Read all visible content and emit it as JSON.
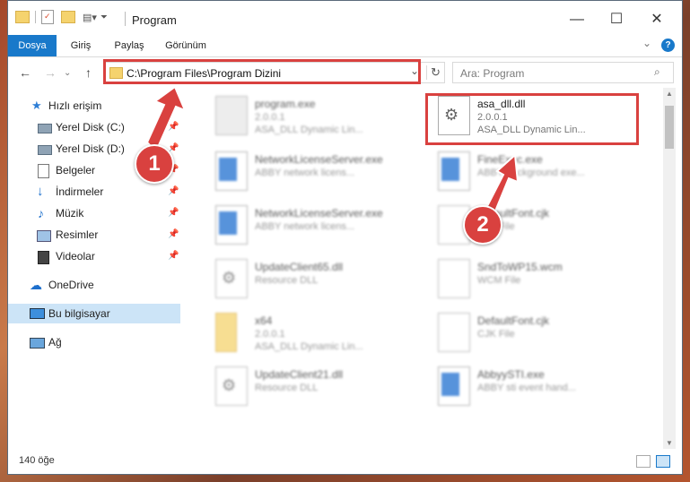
{
  "window": {
    "title": "Program",
    "minimize": "—",
    "maximize": "☐",
    "close": "✕"
  },
  "ribbon": {
    "tabs": [
      {
        "label": "Dosya",
        "active": true
      },
      {
        "label": "Giriş"
      },
      {
        "label": "Paylaş"
      },
      {
        "label": "Görünüm"
      }
    ],
    "expand": "⌄",
    "help": "?"
  },
  "nav": {
    "back": "←",
    "forward": "→",
    "up": "↑",
    "address": "C:\\Program Files\\Program Dizini",
    "dropdown": "⌄",
    "refresh": "↻",
    "search_placeholder": "Ara: Program"
  },
  "sidebar": {
    "items": [
      {
        "label": "Hızlı erişim",
        "icon": "star-icon"
      },
      {
        "label": "Yerel Disk (C:)",
        "icon": "drive-icon",
        "pinned": true
      },
      {
        "label": "Yerel Disk (D:)",
        "icon": "drive-icon",
        "pinned": true
      },
      {
        "label": "Belgeler",
        "icon": "documents-icon",
        "pinned": true
      },
      {
        "label": "İndirmeler",
        "icon": "download-icon",
        "pinned": true
      },
      {
        "label": "Müzik",
        "icon": "music-icon",
        "pinned": true
      },
      {
        "label": "Resimler",
        "icon": "pictures-icon",
        "pinned": true
      },
      {
        "label": "Videolar",
        "icon": "video-icon",
        "pinned": true
      },
      {
        "label": "OneDrive",
        "icon": "onedrive-icon"
      },
      {
        "label": "Bu bilgisayar",
        "icon": "pc-icon",
        "selected": true
      },
      {
        "label": "Ağ",
        "icon": "network-icon"
      }
    ],
    "pin_glyph": "📌"
  },
  "files": [
    {
      "name": "program.exe",
      "l1": "2.0.0.1",
      "l2": "ASA_DLL Dynamic Lin...",
      "icon": "exe-gear-icon",
      "blur": true
    },
    {
      "name": "asa_dll.dll",
      "l1": "2.0.0.1",
      "l2": "ASA_DLL Dynamic Lin...",
      "icon": "dll-gear-icon",
      "blur": false
    },
    {
      "name": "NetworkLicenseServer.exe",
      "l1": "ABBY network licens...",
      "l2": "",
      "icon": "app-window-icon",
      "blur": true
    },
    {
      "name": "FineExec.exe",
      "l1": "ABBY background exe...",
      "l2": "",
      "icon": "app-window-icon",
      "blur": true
    },
    {
      "name": "NetworkLicenseServer.exe",
      "l1": "ABBY network licens...",
      "l2": "",
      "icon": "app-window-icon",
      "blur": true
    },
    {
      "name": "DefaultFont.cjk",
      "l1": "CJK File",
      "l2": "",
      "icon": "file-icon",
      "blur": true
    },
    {
      "name": "UpdateClient65.dll",
      "l1": "Resource DLL",
      "l2": "",
      "icon": "dll-gear-icon",
      "blur": true
    },
    {
      "name": "SndToWP15.wcm",
      "l1": "WCM File",
      "l2": "",
      "icon": "file-icon",
      "blur": true
    },
    {
      "name": "x64",
      "l1": "2.0.0.1",
      "l2": "ASA_DLL Dynamic Lin...",
      "icon": "folder-icon",
      "blur": true
    },
    {
      "name": "DefaultFont.cjk",
      "l1": "CJK File",
      "l2": "",
      "icon": "file-icon",
      "blur": true
    },
    {
      "name": "UpdateClient21.dll",
      "l1": "Resource DLL",
      "l2": "",
      "icon": "dll-gear-icon",
      "blur": true
    },
    {
      "name": "AbbyySTI.exe",
      "l1": "ABBY sti event hand...",
      "l2": "",
      "icon": "app-window-icon",
      "blur": true
    }
  ],
  "status": {
    "count": "140 öğe"
  },
  "annotations": {
    "step1": "1",
    "step2": "2",
    "color": "#d9413f"
  }
}
